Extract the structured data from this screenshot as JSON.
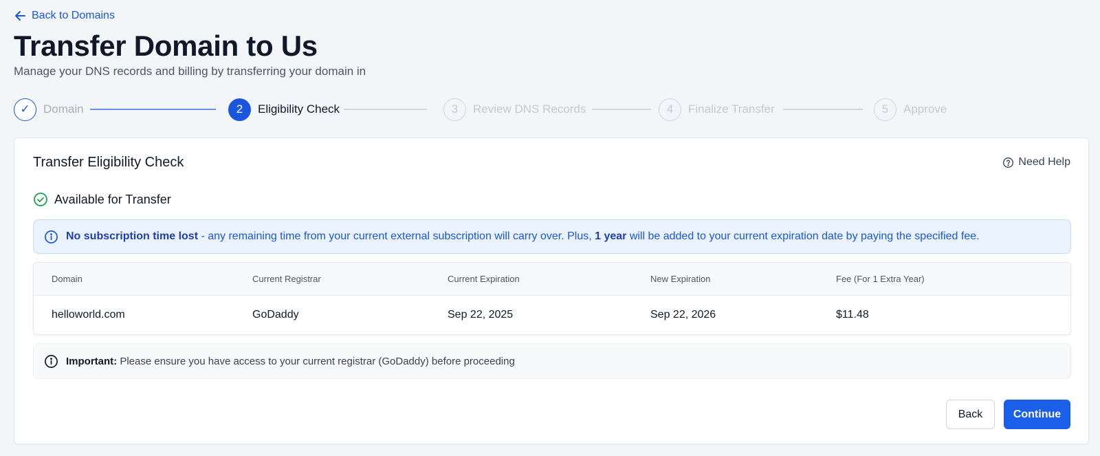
{
  "nav": {
    "back_label": "Back to Domains"
  },
  "header": {
    "title": "Transfer Domain to Us",
    "subtitle": "Manage your DNS records and billing by transferring your domain in"
  },
  "stepper": {
    "steps": [
      {
        "number": "✓",
        "label": "Domain",
        "state": "done"
      },
      {
        "number": "2",
        "label": "Eligibility Check",
        "state": "active"
      },
      {
        "number": "3",
        "label": "Review DNS Records",
        "state": "todo"
      },
      {
        "number": "4",
        "label": "Finalize Transfer",
        "state": "todo"
      },
      {
        "number": "5",
        "label": "Approve",
        "state": "todo"
      }
    ]
  },
  "card": {
    "title": "Transfer Eligibility Check",
    "help_label": "Need Help",
    "status_label": "Available for Transfer",
    "info": {
      "bold1": "No subscription time lost",
      "text1": " - any remaining time from your current external subscription will carry over. Plus, ",
      "bold2": "1 year",
      "text2": " will be added to your current expiration date by paying the specified fee."
    },
    "table": {
      "headers": [
        "Domain",
        "Current Registrar",
        "Current Expiration",
        "New Expiration",
        "Fee (For 1 Extra Year)"
      ],
      "rows": [
        [
          "helloworld.com",
          "GoDaddy",
          "Sep 22, 2025",
          "Sep 22, 2026",
          "$11.48"
        ]
      ]
    },
    "important": {
      "bold": "Important:",
      "text": " Please ensure you have access to your current registrar (GoDaddy) before proceeding"
    },
    "buttons": {
      "back": "Back",
      "continue": "Continue"
    }
  },
  "colors": {
    "accent": "#1a56db",
    "success": "#16a34a",
    "info_bg": "#eaf2fd"
  }
}
